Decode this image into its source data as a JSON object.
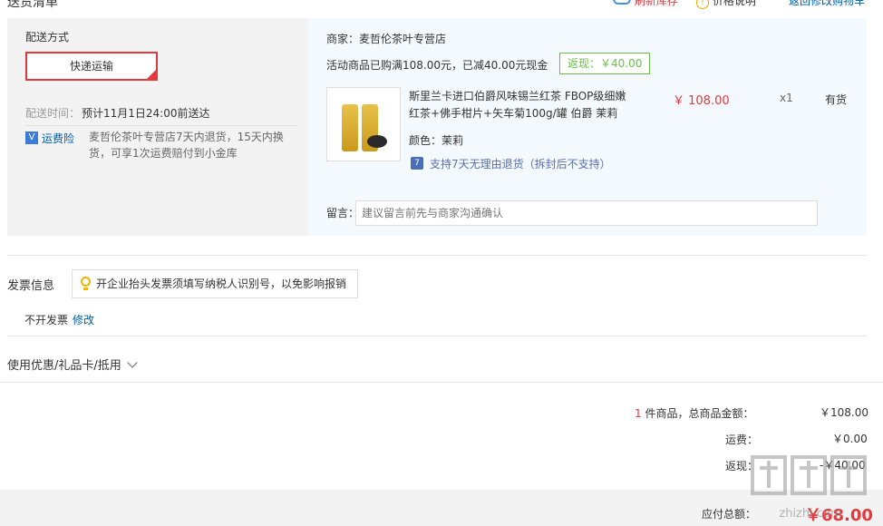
{
  "top": {
    "title": "送货清单",
    "refresh_label": "刷新库存",
    "price_note_label": "价格说明",
    "back_cart_label": "返回修改购物车"
  },
  "shipping": {
    "method_label": "配送方式",
    "express_label": "快递运输",
    "time_label": "配送时间：",
    "time_value": "预计11月1日24:00前送达",
    "insurance_icon": "V",
    "insurance_label": "运费险",
    "insurance_desc": "麦哲伦茶叶专营店7天内退货，15天内换货，可享1次运费赔付到小金库"
  },
  "merchant": {
    "name": "商家：麦哲伦茶叶专营店",
    "promo": "活动商品已购满108.00元，已减40.00元现金",
    "rebate": "返现：￥40.00",
    "product": {
      "title": "斯里兰卡进口伯爵风味锡兰红茶 FBOP级细嫩红茶+佛手柑片+矢车菊100g/罐 伯爵 茉莉",
      "price": "￥ 108.00",
      "qty": "x1",
      "stock": "有货",
      "color": "颜色：茉莉",
      "return_policy": "支持7天无理由退货（拆封后不支持）"
    },
    "message_label": "留言：",
    "message_placeholder": "建议留言前先与商家沟通确认"
  },
  "invoice": {
    "title": "发票信息",
    "tip": "开企业抬头发票须填写纳税人识别号，以免影响报销",
    "status": "不开发票",
    "edit_label": "修改"
  },
  "coupon": {
    "label": "使用优惠/礼品卡/抵用"
  },
  "summary": {
    "count": "1",
    "count_suffix": "件商品，总商品金额：",
    "goods_amount": "￥108.00",
    "shipping_label": "运费：",
    "shipping_amount": "￥0.00",
    "rebate_label": "返现：",
    "rebate_amount": "-￥40.00",
    "payable_label": "应付总额：",
    "payable_amount": "￥68.00"
  },
  "colors": {
    "accent": "#e4393c",
    "link": "#005ea7",
    "rebate_green": "#6abf4b"
  }
}
